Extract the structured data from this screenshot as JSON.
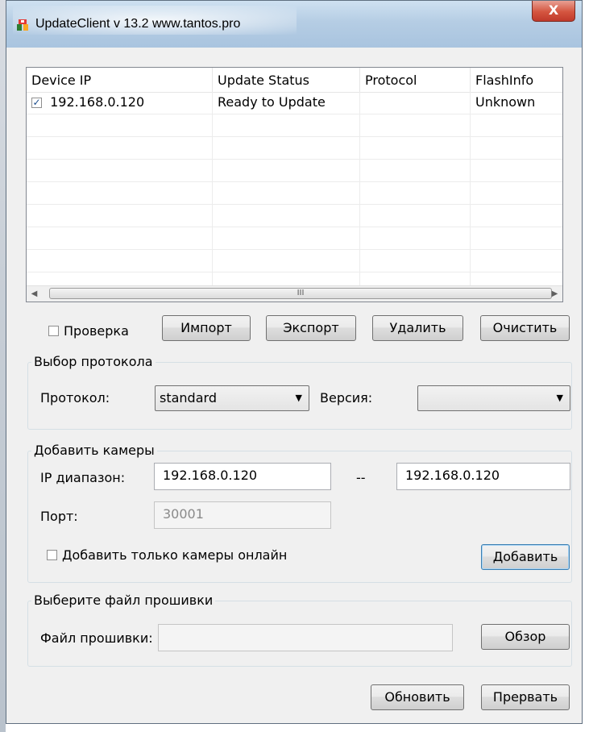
{
  "window": {
    "title": "UpdateClient v 13.2 www.tantos.pro",
    "close_label": "X"
  },
  "device_list": {
    "columns": [
      "Device IP",
      "Update Status",
      "Protocol",
      "FlashInfo"
    ],
    "rows": [
      {
        "checked": true,
        "device_ip": "192.168.0.120",
        "update_status": "Ready to Update",
        "protocol": "",
        "flash_info": "Unknown"
      }
    ],
    "scrollbar_thumb_label": "III"
  },
  "list_actions": {
    "check_label": "Проверка",
    "check_checked": false,
    "import_label": "Импорт",
    "export_label": "Экспорт",
    "delete_label": "Удалить",
    "clear_label": "Очистить"
  },
  "protocol_group": {
    "title": "Выбор протокола",
    "protocol_label": "Протокол:",
    "protocol_value": "standard",
    "version_label": "Версия:",
    "version_value": ""
  },
  "add_cameras_group": {
    "title": "Добавить камеры",
    "ip_range_label": "IP диапазон:",
    "ip_from": "192.168.0.120",
    "range_separator": "--",
    "ip_to": "192.168.0.120",
    "port_label": "Порт:",
    "port_value": "30001",
    "online_only_label": "Добавить только камеры онлайн",
    "online_only_checked": false,
    "add_label": "Добавить"
  },
  "firmware_group": {
    "title": "Выберите файл прошивки",
    "file_label": "Файл прошивки:",
    "file_value": "",
    "browse_label": "Обзор"
  },
  "footer": {
    "update_label": "Обновить",
    "abort_label": "Прервать"
  },
  "colors": {
    "titlebar": "#b5cde4",
    "close_button": "#c0392b",
    "dialog_background": "#f0f0f0",
    "default_button_border": "#3c7fb1"
  }
}
